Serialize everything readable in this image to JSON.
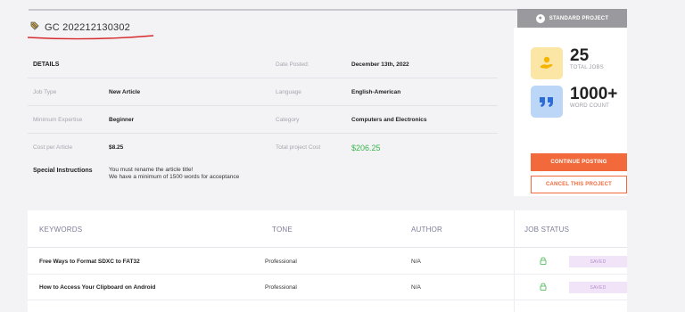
{
  "header": {
    "project_id": "GC 202212130302",
    "badge": "STANDARD PROJECT"
  },
  "details": {
    "heading": "DETAILS",
    "date_posted_label": "Date Posted:",
    "date_posted_value": "December 13th, 2022",
    "job_type_label": "Job Type",
    "job_type_value": "New Article",
    "language_label": "Language",
    "language_value": "English-American",
    "expertise_label": "Minimum Expertise",
    "expertise_value": "Beginner",
    "category_label": "Category",
    "category_value": "Computers and Electronics",
    "cost_label": "Cost per Article",
    "cost_value": "$8.25",
    "total_label": "Total project Cost",
    "total_value": "$206.25",
    "instructions_label": "Special Instructions",
    "instructions_line1": "You must rename the article title!",
    "instructions_line2": "We have a minimum of 1500 words for acceptance"
  },
  "stats": {
    "jobs_count": "25",
    "jobs_label": "TOTAL JOBS",
    "words_count": "1000+",
    "words_label": "WORD COUNT"
  },
  "actions": {
    "continue": "CONTINUE POSTING",
    "cancel": "CANCEL THIS PROJECT"
  },
  "table": {
    "headers": [
      "KEYWORDS",
      "TONE",
      "AUTHOR",
      "JOB STATUS"
    ],
    "rows": [
      {
        "keyword": "Free Ways to Format SDXC to FAT32",
        "tone": "Professional",
        "author": "N/A",
        "status": "SAVED"
      },
      {
        "keyword": "How to Access Your Clipboard on Android",
        "tone": "Professional",
        "author": "N/A",
        "status": "SAVED"
      }
    ]
  },
  "colors": {
    "accent_orange": "#f26a3b",
    "money_green": "#3bb54a",
    "badge_grey": "#9a9a9e",
    "saved_bg": "#f1e4f8",
    "jobs_icon_bg": "#fbe6a6",
    "words_icon_bg": "#bcd6f7"
  },
  "icons": [
    "tag-icon",
    "chat-bubble-icon",
    "hand-coin-icon",
    "quote-icon",
    "lock-icon"
  ]
}
